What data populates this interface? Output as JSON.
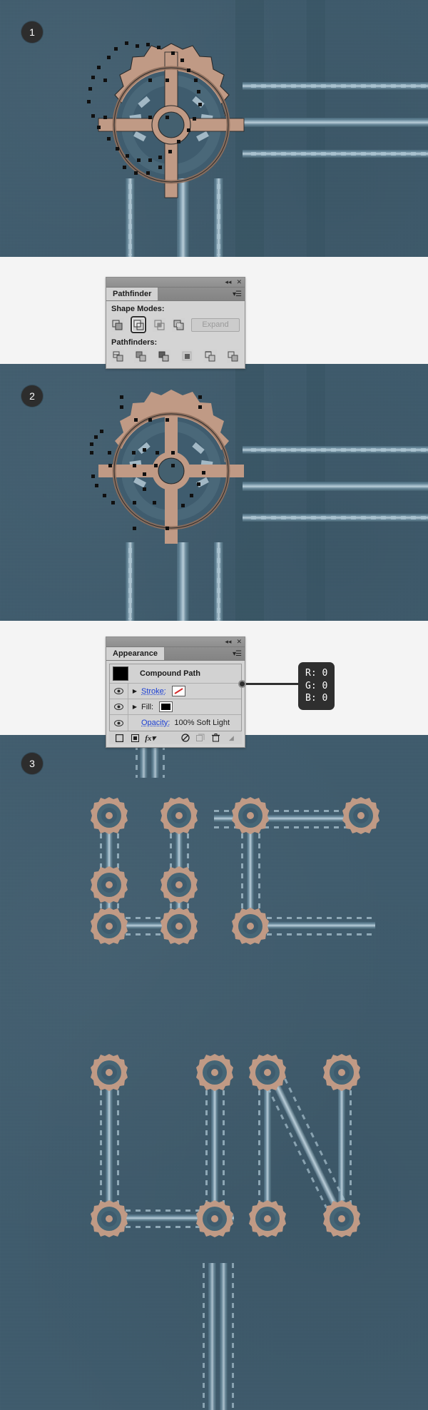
{
  "doc": {
    "title": "Illustrator steampunk gear tutorial steps",
    "background_color": "#f4f4f4",
    "canvas_color": "#3d5a6c",
    "gear_color": "#c09a85",
    "pipe_highlight": "#b9cdd8"
  },
  "steps": [
    {
      "number": "1",
      "caption": ""
    },
    {
      "number": "2",
      "caption": ""
    },
    {
      "number": "3",
      "caption": ""
    }
  ],
  "pathfinder_panel": {
    "tab_label": "Pathfinder",
    "collapse_icon": "collapse-icon",
    "close_icon": "close-icon",
    "menu_icon": "panel-menu-icon",
    "shape_modes_label": "Shape Modes:",
    "pathfinders_label": "Pathfinders:",
    "expand_label": "Expand",
    "expand_enabled": false,
    "shape_modes": [
      {
        "name": "unite",
        "selected": false
      },
      {
        "name": "minus-front",
        "selected": true
      },
      {
        "name": "intersect",
        "selected": false
      },
      {
        "name": "exclude",
        "selected": false
      }
    ],
    "pathfinders": [
      {
        "name": "divide"
      },
      {
        "name": "trim"
      },
      {
        "name": "merge"
      },
      {
        "name": "crop"
      },
      {
        "name": "outline"
      },
      {
        "name": "minus-back"
      }
    ]
  },
  "appearance_panel": {
    "tab_label": "Appearance",
    "collapse_icon": "collapse-icon",
    "close_icon": "close-icon",
    "menu_icon": "panel-menu-icon",
    "object_type": "Compound Path",
    "rows": [
      {
        "label": "Stroke:",
        "is_link": true,
        "swatch": "none-red-slash",
        "has_arrow": true,
        "visible": true
      },
      {
        "label": "Fill:",
        "is_link": false,
        "swatch": "black",
        "has_arrow": true,
        "visible": true
      }
    ],
    "opacity_label": "Opacity:",
    "opacity_value": "100% Soft Light",
    "footer_icons": [
      "add-new-stroke-icon",
      "add-new-fill-icon",
      "add-new-effect-icon",
      "clear-appearance-icon",
      "duplicate-item-icon",
      "delete-item-icon"
    ]
  },
  "callout": {
    "lines": [
      "R: 0",
      "G: 0",
      "B: 0"
    ],
    "target_row": "Fill:"
  }
}
